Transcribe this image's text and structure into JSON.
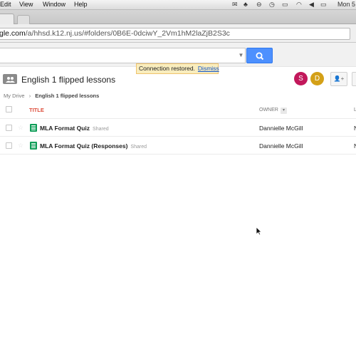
{
  "menubar": {
    "items": [
      "Edit",
      "View",
      "Window",
      "Help"
    ],
    "clock": "Mon 5"
  },
  "address_bar": {
    "url_host": "gle.com",
    "url_path": "/a/hhsd.k12.nj.us/#folders/0B6E-0dciwY_2Vm1hM2laZjB2S3c"
  },
  "search": {
    "value": ""
  },
  "notification": {
    "text": "Connection restored.",
    "dismiss_label": "Dismiss"
  },
  "folder": {
    "title": "English 1 flipped lessons",
    "collaborators": [
      {
        "initial": "S",
        "color": "#c2185b"
      },
      {
        "initial": "D",
        "color": "#d4a017"
      }
    ]
  },
  "breadcrumb": {
    "root": "My Drive",
    "separator": "›",
    "current": "English 1 flipped lessons"
  },
  "table": {
    "columns": {
      "title": "TITLE",
      "owner": "OWNER",
      "last": "L"
    },
    "rows": [
      {
        "name": "MLA Format Quiz",
        "badge": "Shared",
        "owner": "Dannielle McGill",
        "last": "N"
      },
      {
        "name": "MLA Format Quiz (Responses)",
        "badge": "Shared",
        "owner": "Dannielle McGill",
        "last": "N"
      }
    ]
  }
}
